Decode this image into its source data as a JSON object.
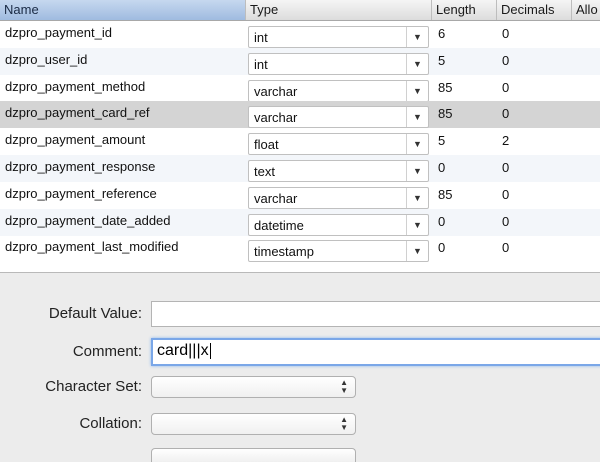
{
  "columns": {
    "name": "Name",
    "type": "Type",
    "length": "Length",
    "decimals": "Decimals",
    "allow_null": "Allo"
  },
  "rows": [
    {
      "name": "dzpro_payment_id",
      "type": "int",
      "length": "6",
      "decimals": "0"
    },
    {
      "name": "dzpro_user_id",
      "type": "int",
      "length": "5",
      "decimals": "0"
    },
    {
      "name": "dzpro_payment_method",
      "type": "varchar",
      "length": "85",
      "decimals": "0"
    },
    {
      "name": "dzpro_payment_card_ref",
      "type": "varchar",
      "length": "85",
      "decimals": "0",
      "selected": true
    },
    {
      "name": "dzpro_payment_amount",
      "type": "float",
      "length": "5",
      "decimals": "2"
    },
    {
      "name": "dzpro_payment_response",
      "type": "text",
      "length": "0",
      "decimals": "0"
    },
    {
      "name": "dzpro_payment_reference",
      "type": "varchar",
      "length": "85",
      "decimals": "0"
    },
    {
      "name": "dzpro_payment_date_added",
      "type": "datetime",
      "length": "0",
      "decimals": "0"
    },
    {
      "name": "dzpro_payment_last_modified",
      "type": "timestamp",
      "length": "0",
      "decimals": "0"
    }
  ],
  "form": {
    "default_value": {
      "label": "Default Value:",
      "value": ""
    },
    "comment": {
      "label": "Comment:",
      "value": "card|||x"
    },
    "character_set": {
      "label": "Character Set:",
      "value": ""
    },
    "collation": {
      "label": "Collation:",
      "value": ""
    }
  },
  "icons": {
    "dropdown": "▼",
    "stepper": "▲▼"
  },
  "colors": {
    "selected_row": "#d4d4d4",
    "sorted_header": "#b3cae8",
    "focus_ring": "#7aa7e8"
  }
}
